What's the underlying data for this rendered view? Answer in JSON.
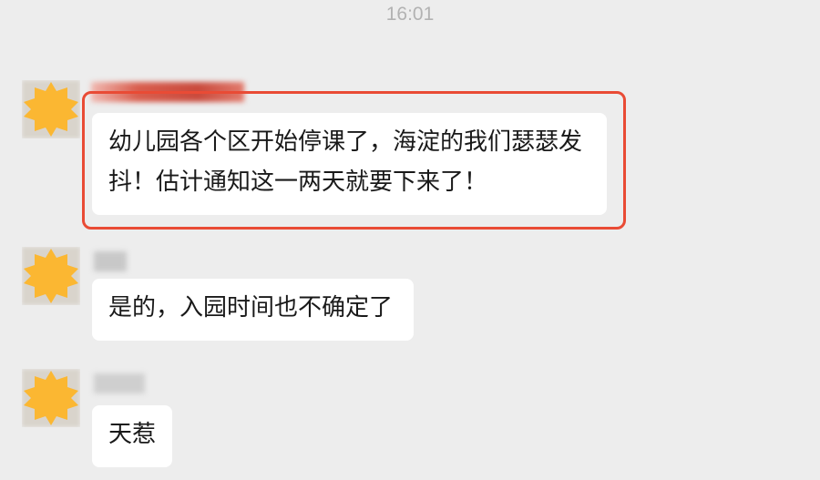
{
  "chat": {
    "timestamp": "16:01",
    "messages": [
      {
        "avatar": "avatar-icon",
        "text_line1": "幼儿园各个区开始停课了，海淀的我们瑟瑟发",
        "text_line2": "抖！估计通知这一两天就要下来了！"
      },
      {
        "avatar": "avatar-icon",
        "text": "是的，入园时间也不确定了"
      },
      {
        "avatar": "avatar-icon",
        "text": "天惹"
      }
    ]
  },
  "colors": {
    "background": "#ededed",
    "bubble": "#ffffff",
    "highlight": "#e94b35",
    "avatar_badge": "#fbb732",
    "timestamp": "#b2b2b2"
  }
}
